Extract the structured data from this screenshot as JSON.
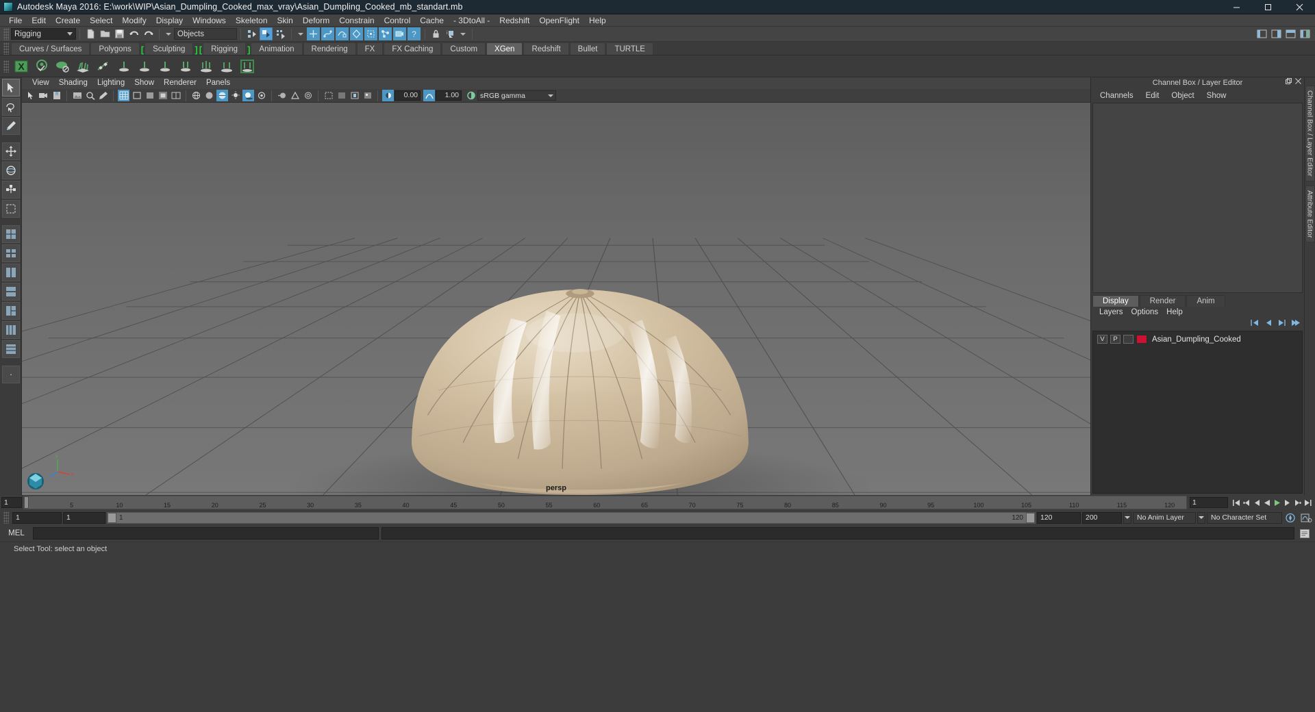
{
  "window": {
    "title": "Autodesk Maya 2016: E:\\work\\WIP\\Asian_Dumpling_Cooked_max_vray\\Asian_Dumpling_Cooked_mb_standart.mb",
    "minimize": "–",
    "maximize": "□",
    "close": "✕"
  },
  "menubar": {
    "items": [
      "File",
      "Edit",
      "Create",
      "Select",
      "Modify",
      "Display",
      "Windows",
      "Skeleton",
      "Skin",
      "Deform",
      "Constrain",
      "Control",
      "Cache",
      "- 3DtoAll -",
      "Redshift",
      "OpenFlight",
      "Help"
    ]
  },
  "statusline": {
    "menu_set": "Rigging",
    "selection_mask": "Objects",
    "icons": [
      "new-scene-icon",
      "open-scene-icon",
      "save-scene-icon",
      "undo-icon",
      "redo-icon",
      "select-by-hierarchy-icon",
      "select-by-object-icon",
      "select-by-component-icon",
      "mask-handle-icon",
      "mask-curve-icon",
      "mask-surface-icon",
      "mask-deformer-icon",
      "mask-light-icon",
      "mask-joint-icon",
      "mask-camera-icon",
      "mask-misc-icon",
      "lock-icon",
      "history-icon",
      "render-current-frame-icon",
      "ipr-render-icon",
      "render-settings-icon"
    ],
    "right_icons": [
      "show-hide-modeling-toolkit-icon",
      "show-hide-attribute-editor-icon",
      "show-hide-tool-settings-icon",
      "show-hide-channel-box-icon"
    ]
  },
  "shelf": {
    "tabs": [
      {
        "label": "Curves / Surfaces",
        "active": false,
        "bracket": false
      },
      {
        "label": "Polygons",
        "active": false,
        "bracket": false
      },
      {
        "label": "Sculpting",
        "active": false,
        "bracket": true
      },
      {
        "label": "Rigging",
        "active": false,
        "bracket": true
      },
      {
        "label": "Animation",
        "active": false,
        "bracket": false
      },
      {
        "label": "Rendering",
        "active": false,
        "bracket": false
      },
      {
        "label": "FX",
        "active": false,
        "bracket": false
      },
      {
        "label": "FX Caching",
        "active": false,
        "bracket": false
      },
      {
        "label": "Custom",
        "active": false,
        "bracket": false
      },
      {
        "label": "XGen",
        "active": true,
        "bracket": false
      },
      {
        "label": "Redshift",
        "active": false,
        "bracket": false
      },
      {
        "label": "Bullet",
        "active": false,
        "bracket": false
      },
      {
        "label": "TURTLE",
        "active": false,
        "bracket": false
      }
    ],
    "icons": [
      "xgen-editor-icon",
      "xgen-create-description-icon",
      "xgen-create-collection-icon",
      "xgen-add-grooming-icon",
      "xgen-add-guides-icon",
      "xgen-preview-icon",
      "xgen-clump-icon",
      "xgen-noise-icon",
      "xgen-cut-icon",
      "xgen-density-icon",
      "xgen-region-icon",
      "xgen-export-icon"
    ]
  },
  "toolbox": {
    "items": [
      "select-tool-icon",
      "lasso-select-tool-icon",
      "paint-select-tool-icon",
      "move-tool-icon",
      "rotate-tool-icon",
      "scale-tool-icon",
      "last-tool-used-icon",
      "quad-view-layout-icon",
      "single-perspective-layout-icon",
      "two-panes-side-icon",
      "two-panes-stacked-icon",
      "three-panes-split-icon",
      "four-panes-icon",
      "persp-outliner-layout-icon",
      "more-layouts-icon"
    ]
  },
  "viewport": {
    "menus": [
      "View",
      "Shading",
      "Lighting",
      "Show",
      "Renderer",
      "Panels"
    ],
    "toolbar_icons": [
      "select-camera-icon",
      "camera-attributes-icon",
      "bookmarks-icon",
      "image-plane-icon",
      "two-d-pan-zoom-icon",
      "grease-pencil-icon",
      "grid-toggle-icon",
      "film-gate-icon",
      "resolution-gate-icon",
      "gate-mask-icon",
      "field-chart-icon",
      "safe-action-icon",
      "safe-title-icon",
      "wireframe-icon",
      "smooth-shade-all-icon",
      "shade-with-wireframe-icon",
      "use-all-lights-icon",
      "shadows-icon",
      "screen-space-ao-icon",
      "motion-blur-icon",
      "multisample-aa-icon",
      "depth-of-field-icon",
      "isolate-select-icon",
      "xray-icon",
      "xray-joints-icon",
      "xray-active-components-icon",
      "exposure-toggle-icon",
      "gamma-toggle-icon",
      "color-management-icon"
    ],
    "exposure_value": "0.00",
    "gamma_value": "1.00",
    "color_management": "sRGB gamma",
    "camera_label": "persp",
    "axis_labels": {
      "x": "x",
      "y": "y",
      "z": "z"
    }
  },
  "right_dock": {
    "panel_title": "Channel Box / Layer Editor",
    "float_icon": "undock-icon",
    "close_icon": "close-icon",
    "channel_tabs": [
      "Channels",
      "Edit",
      "Object",
      "Show"
    ],
    "layer_editor_tabs": [
      {
        "label": "Display",
        "active": true
      },
      {
        "label": "Render",
        "active": false
      },
      {
        "label": "Anim",
        "active": false
      }
    ],
    "layer_menus": [
      "Layers",
      "Options",
      "Help"
    ],
    "layer_toolbar_icons": [
      "move-layer-up-icon",
      "move-layer-down-icon",
      "new-layer-icon",
      "new-layer-from-selected-icon"
    ],
    "layers": [
      {
        "visibility": "V",
        "playback": "P",
        "type": "",
        "color": "#cc1133",
        "name": "Asian_Dumpling_Cooked"
      }
    ],
    "side_tabs": [
      "Channel Box / Layer Editor",
      "Attribute Editor"
    ]
  },
  "timeline": {
    "current_frame_left": "1",
    "ticks": [
      "5",
      "10",
      "15",
      "20",
      "25",
      "30",
      "35",
      "40",
      "45",
      "50",
      "55",
      "60",
      "65",
      "70",
      "75",
      "80",
      "85",
      "90",
      "95",
      "100",
      "105",
      "110",
      "115",
      "120"
    ],
    "frame_field": "1",
    "playback_buttons": [
      "go-to-start-icon",
      "step-back-key-icon",
      "step-back-frame-icon",
      "play-backwards-icon",
      "play-forwards-icon",
      "step-forward-frame-icon",
      "step-forward-key-icon",
      "go-to-end-icon"
    ]
  },
  "range_slider": {
    "anim_start": "1",
    "range_start": "1",
    "slider_start_label": "1",
    "slider_end_label": "120",
    "range_end": "120",
    "anim_end": "200",
    "anim_layer": "No Anim Layer",
    "character_set": "No Character Set",
    "auto_key_icon": "auto-keyframe-icon",
    "anim_prefs_icon": "animation-preferences-icon"
  },
  "command_line": {
    "label": "MEL",
    "input_value": "",
    "output_value": "",
    "script_editor_icon": "script-editor-icon"
  },
  "status_bar": {
    "help_text": "Select Tool: select an object"
  },
  "colors": {
    "titlebar": "#1e2a33",
    "chrome": "#3c3c3c",
    "accent_blue": "#4d97c4",
    "shelf_green": "#23d23d",
    "layer_red": "#cc1133",
    "viewport_bg": "#6a6a6a",
    "dumpling": "#cdb796"
  }
}
